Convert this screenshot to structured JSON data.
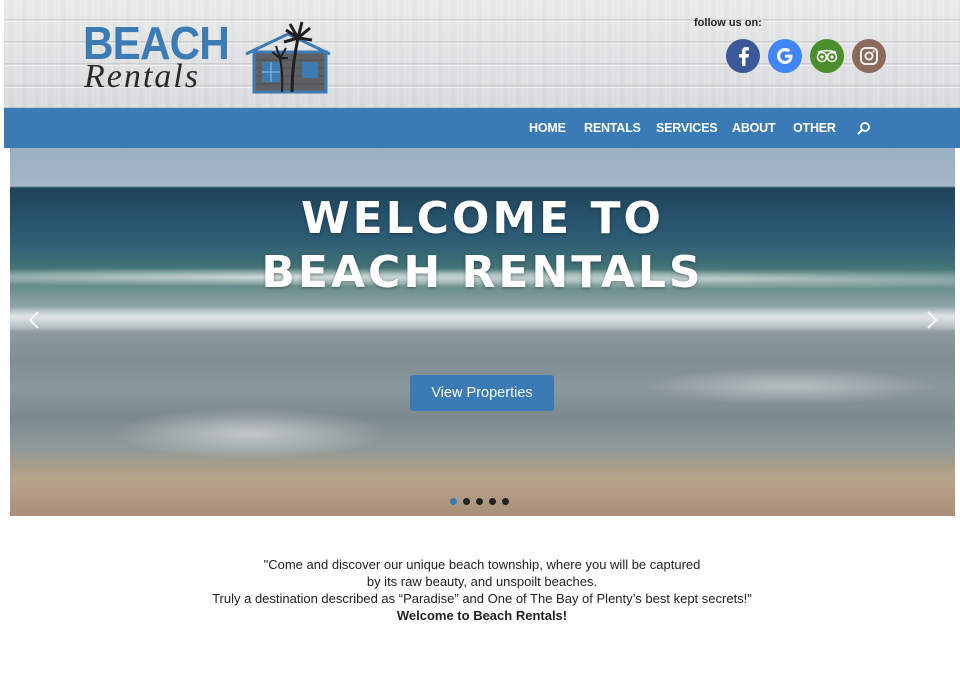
{
  "header": {
    "logo": {
      "line1": "BEACH",
      "line2": "Rentals"
    },
    "follow_label": "follow us on:",
    "social": [
      {
        "name": "Facebook",
        "icon": "facebook-icon",
        "color": "#3b5998"
      },
      {
        "name": "Google",
        "icon": "google-icon",
        "color": "#4285f4"
      },
      {
        "name": "TripAdvisor",
        "icon": "tripadvisor-icon",
        "color": "#4b8f2c"
      },
      {
        "name": "Instagram",
        "icon": "instagram-icon",
        "color": "#8b6a5c"
      }
    ]
  },
  "nav": {
    "items": [
      "HOME",
      "RENTALS",
      "SERVICES",
      "ABOUT",
      "OTHER"
    ],
    "search_icon": "search-icon",
    "color": "#3a7ab5"
  },
  "hero": {
    "title_line1": "WELCOME TO",
    "title_line2": "BEACH RENTALS",
    "button": "View Properties",
    "prev_icon": "chevron-left-icon",
    "next_icon": "chevron-right-icon",
    "slide_count": 5,
    "active_slide": 1
  },
  "intro": {
    "line1": "\"Come and discover our unique beach township,  where you will be captured",
    "line2": "by its raw beauty, and unspoilt beaches.",
    "line3": "Truly a destination described as “Paradise” and  One of The Bay of Plenty’s best kept secrets!\"",
    "line4": "Welcome to Beach Rentals!"
  }
}
